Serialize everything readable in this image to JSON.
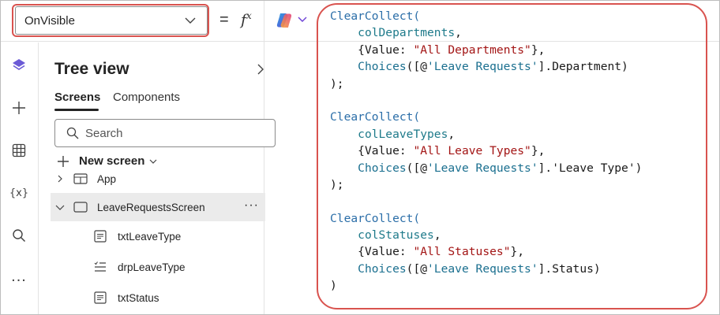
{
  "formula_bar": {
    "property": "OnVisible",
    "equals": "=",
    "fx_f": "f",
    "fx_x": "x"
  },
  "tree_view": {
    "title": "Tree view",
    "tabs": [
      {
        "label": "Screens",
        "active": true
      },
      {
        "label": "Components",
        "active": false
      }
    ],
    "search_placeholder": "Search",
    "new_screen_label": "New screen",
    "items": [
      {
        "label": "App",
        "icon": "app-icon"
      },
      {
        "label": "LeaveRequestsScreen",
        "icon": "screen-icon",
        "selected": true
      },
      {
        "label": "txtLeaveType",
        "icon": "label-icon"
      },
      {
        "label": "drpLeaveType",
        "icon": "dropdown-icon"
      },
      {
        "label": "txtStatus",
        "icon": "label-icon"
      }
    ]
  },
  "rail": {
    "icons": [
      "layers-icon",
      "plus-icon",
      "table-icon",
      "variable-icon",
      "search-icon",
      "more-icon"
    ],
    "variable_label": "{x}",
    "more_label": "..."
  },
  "code": {
    "lines": [
      [
        {
          "t": "fn",
          "v": "ClearCollect("
        }
      ],
      [
        {
          "t": "sp",
          "v": "    "
        },
        {
          "t": "id",
          "v": "colDepartments"
        },
        {
          "t": "punc",
          "v": ","
        }
      ],
      [
        {
          "t": "sp",
          "v": "    "
        },
        {
          "t": "punc",
          "v": "{"
        },
        {
          "t": "key",
          "v": "Value"
        },
        {
          "t": "punc",
          "v": ": "
        },
        {
          "t": "str",
          "v": "\"All Departments\""
        },
        {
          "t": "punc",
          "v": "},"
        }
      ],
      [
        {
          "t": "sp",
          "v": "    "
        },
        {
          "t": "ch",
          "v": "Choices"
        },
        {
          "t": "punc",
          "v": "([@"
        },
        {
          "t": "ch",
          "v": "'Leave Requests'"
        },
        {
          "t": "punc",
          "v": "].Department)"
        }
      ],
      [
        {
          "t": "punc",
          "v": ");"
        }
      ],
      [
        {
          "t": "sp",
          "v": ""
        }
      ],
      [
        {
          "t": "fn",
          "v": "ClearCollect("
        }
      ],
      [
        {
          "t": "sp",
          "v": "    "
        },
        {
          "t": "id",
          "v": "colLeaveTypes"
        },
        {
          "t": "punc",
          "v": ","
        }
      ],
      [
        {
          "t": "sp",
          "v": "    "
        },
        {
          "t": "punc",
          "v": "{"
        },
        {
          "t": "key",
          "v": "Value"
        },
        {
          "t": "punc",
          "v": ": "
        },
        {
          "t": "str",
          "v": "\"All Leave Types\""
        },
        {
          "t": "punc",
          "v": "},"
        }
      ],
      [
        {
          "t": "sp",
          "v": "    "
        },
        {
          "t": "ch",
          "v": "Choices"
        },
        {
          "t": "punc",
          "v": "([@"
        },
        {
          "t": "ch",
          "v": "'Leave Requests'"
        },
        {
          "t": "punc",
          "v": "].'Leave Type')"
        }
      ],
      [
        {
          "t": "punc",
          "v": ");"
        }
      ],
      [
        {
          "t": "sp",
          "v": ""
        }
      ],
      [
        {
          "t": "fn",
          "v": "ClearCollect("
        }
      ],
      [
        {
          "t": "sp",
          "v": "    "
        },
        {
          "t": "id",
          "v": "colStatuses"
        },
        {
          "t": "punc",
          "v": ","
        }
      ],
      [
        {
          "t": "sp",
          "v": "    "
        },
        {
          "t": "punc",
          "v": "{"
        },
        {
          "t": "key",
          "v": "Value"
        },
        {
          "t": "punc",
          "v": ": "
        },
        {
          "t": "str",
          "v": "\"All Statuses\""
        },
        {
          "t": "punc",
          "v": "},"
        }
      ],
      [
        {
          "t": "sp",
          "v": "    "
        },
        {
          "t": "ch",
          "v": "Choices"
        },
        {
          "t": "punc",
          "v": "([@"
        },
        {
          "t": "ch",
          "v": "'Leave Requests'"
        },
        {
          "t": "punc",
          "v": "].Status)"
        }
      ],
      [
        {
          "t": "punc",
          "v": ")"
        }
      ]
    ]
  },
  "colors": {
    "highlight_outline": "#d9534f",
    "function": "#2b6ea8",
    "identifier": "#1e7a8a",
    "string": "#a31515",
    "selected_row": "#ebebeb"
  }
}
